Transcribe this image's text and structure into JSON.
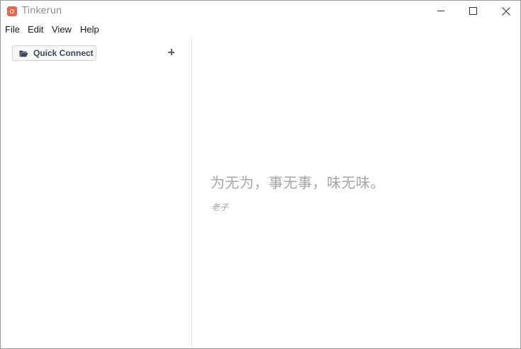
{
  "window": {
    "title": "Tinkerun",
    "accent_color": "#e8684f"
  },
  "menu": {
    "file": "File",
    "edit": "Edit",
    "view": "View",
    "help": "Help"
  },
  "sidebar": {
    "quick_connect_label": "Quick Connect",
    "folder_icon": "folder-open-icon",
    "add_icon": "plus-icon"
  },
  "main": {
    "quote": "为无为，事无事，味无味。",
    "author": "老子"
  }
}
